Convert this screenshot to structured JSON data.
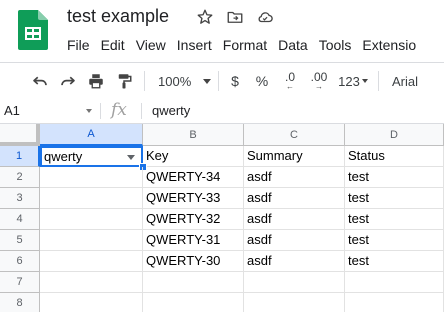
{
  "doc": {
    "title": "test example"
  },
  "menu": [
    "File",
    "Edit",
    "View",
    "Insert",
    "Format",
    "Data",
    "Tools",
    "Extensio"
  ],
  "toolbar": {
    "zoom": "100%",
    "currency": "$",
    "percent": "%",
    "dec_decrease": ".0",
    "dec_increase": ".00",
    "more_formats": "123",
    "font": "Arial"
  },
  "formula_bar": {
    "cell_ref": "A1",
    "fx": "fx",
    "value": "qwerty"
  },
  "colors": {
    "accent": "#1a73e8",
    "sheets_green": "#0f9d58",
    "header_bg": "#f8f9fa"
  },
  "grid": {
    "columns": [
      "A",
      "B",
      "C",
      "D"
    ],
    "rows": [
      "1",
      "2",
      "3",
      "4",
      "5",
      "6",
      "7",
      "8"
    ],
    "cells": [
      [
        "qwerty",
        "Key",
        "Summary",
        "Status"
      ],
      [
        "",
        "QWERTY-34",
        "asdf",
        "test"
      ],
      [
        "",
        "QWERTY-33",
        "asdf",
        "test"
      ],
      [
        "",
        "QWERTY-32",
        "asdf",
        "test"
      ],
      [
        "",
        "QWERTY-31",
        "asdf",
        "test"
      ],
      [
        "",
        "QWERTY-30",
        "asdf",
        "test"
      ],
      [
        "",
        "",
        "",
        ""
      ],
      [
        "",
        "",
        "",
        ""
      ]
    ]
  }
}
